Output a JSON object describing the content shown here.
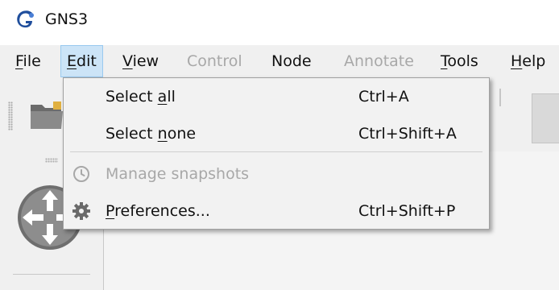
{
  "app": {
    "title": "GNS3"
  },
  "menubar": {
    "items": [
      {
        "label_prefix": "",
        "label_mnemonic": "F",
        "label_rest": "ile",
        "enabled": true,
        "active": false
      },
      {
        "label_prefix": "",
        "label_mnemonic": "E",
        "label_rest": "dit",
        "enabled": true,
        "active": true
      },
      {
        "label_prefix": "",
        "label_mnemonic": "V",
        "label_rest": "iew",
        "enabled": true,
        "active": false
      },
      {
        "label_prefix": "Control",
        "label_mnemonic": "",
        "label_rest": "",
        "enabled": false,
        "active": false
      },
      {
        "label_prefix": "Node",
        "label_mnemonic": "",
        "label_rest": "",
        "enabled": true,
        "active": false
      },
      {
        "label_prefix": "Annotate",
        "label_mnemonic": "",
        "label_rest": "",
        "enabled": false,
        "active": false
      },
      {
        "label_prefix": "",
        "label_mnemonic": "T",
        "label_rest": "ools",
        "enabled": true,
        "active": false
      },
      {
        "label_prefix": "",
        "label_mnemonic": "H",
        "label_rest": "elp",
        "enabled": true,
        "active": false
      }
    ]
  },
  "edit_menu": {
    "select_all": {
      "label_prefix": "Select ",
      "label_mnemonic": "a",
      "label_rest": "ll",
      "shortcut": "Ctrl+A",
      "enabled": true
    },
    "select_none": {
      "label_prefix": "Select ",
      "label_mnemonic": "n",
      "label_rest": "one",
      "shortcut": "Ctrl+Shift+A",
      "enabled": true
    },
    "manage_snapshots": {
      "label": "Manage snapshots",
      "icon": "clock-icon",
      "enabled": false
    },
    "preferences": {
      "label_prefix": "",
      "label_mnemonic": "P",
      "label_rest": "references...",
      "shortcut": "Ctrl+Shift+P",
      "icon": "gear-icon",
      "enabled": true
    }
  },
  "colors": {
    "menu_highlight": "#cce4f7",
    "menu_highlight_border": "#99c9ef",
    "disabled_text": "#a8a8a8",
    "app_icon_blue": "#1f4e9c"
  }
}
